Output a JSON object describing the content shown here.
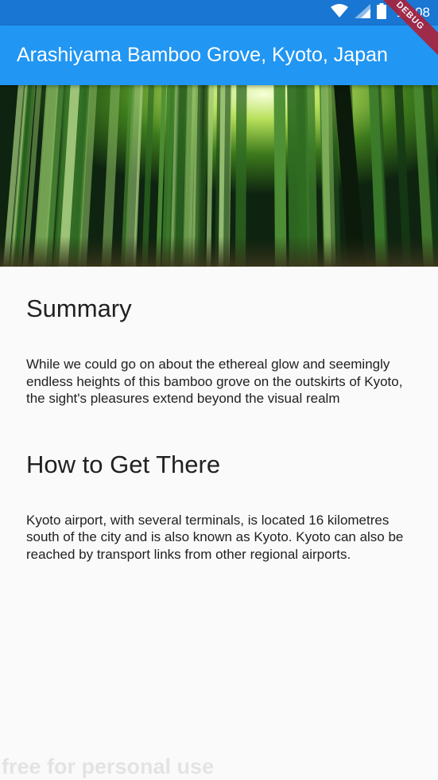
{
  "status_bar": {
    "time": "12:08",
    "icons": [
      "wifi-icon",
      "signal-icon",
      "battery-icon"
    ],
    "background": "#1976d2"
  },
  "app_bar": {
    "title": "Arashiyama Bamboo Grove, Kyoto, Japan",
    "background": "#2196f3"
  },
  "debug_banner": {
    "label": "DEBUG",
    "color": "#a9223c"
  },
  "hero_image": {
    "subject": "bamboo grove"
  },
  "sections": [
    {
      "title": "Summary",
      "body": "While we could go on about the ethereal glow and seemingly endless heights of this bamboo grove on the outskirts of Kyoto, the sight's pleasures extend beyond the visual realm"
    },
    {
      "title": "How to Get There",
      "body": "Kyoto airport, with several terminals, is located 16 kilometres south of the city and is also known as Kyoto. Kyoto can also be reached by transport links from other regional airports."
    }
  ],
  "watermark": "free for personal use"
}
